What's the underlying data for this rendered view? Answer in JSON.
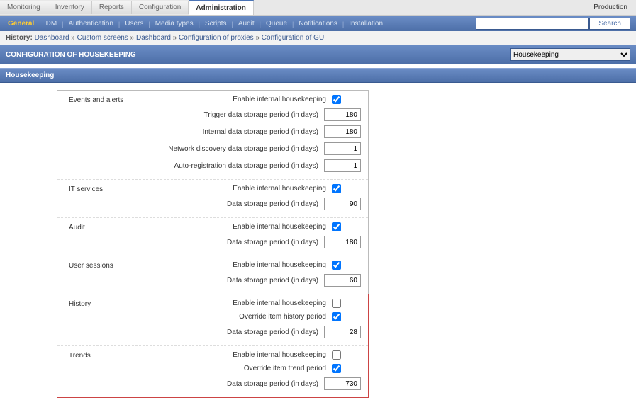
{
  "env": "Production",
  "topTabs": [
    "Monitoring",
    "Inventory",
    "Reports",
    "Configuration",
    "Administration"
  ],
  "topTabActive": "Administration",
  "subTabs": [
    "General",
    "DM",
    "Authentication",
    "Users",
    "Media types",
    "Scripts",
    "Audit",
    "Queue",
    "Notifications",
    "Installation"
  ],
  "search": {
    "placeholder": "",
    "button": "Search"
  },
  "history": {
    "label": "History:",
    "items": [
      "Dashboard",
      "Custom screens",
      "Dashboard",
      "Configuration of proxies",
      "Configuration of GUI"
    ]
  },
  "pageTitle": "CONFIGURATION OF HOUSEKEEPING",
  "selector": {
    "selected": "Housekeeping"
  },
  "sectionTitle": "Housekeeping",
  "groups": [
    {
      "name": "Events and alerts",
      "rows": [
        {
          "label": "Enable internal housekeeping",
          "kind": "check",
          "val": true
        },
        {
          "label": "Trigger data storage period (in days)",
          "kind": "text",
          "val": "180"
        },
        {
          "label": "Internal data storage period (in days)",
          "kind": "text",
          "val": "180"
        },
        {
          "label": "Network discovery data storage period (in days)",
          "kind": "text",
          "val": "1"
        },
        {
          "label": "Auto-registration data storage period (in days)",
          "kind": "text",
          "val": "1"
        }
      ]
    },
    {
      "name": "IT services",
      "rows": [
        {
          "label": "Enable internal housekeeping",
          "kind": "check",
          "val": true
        },
        {
          "label": "Data storage period (in days)",
          "kind": "text",
          "val": "90"
        }
      ]
    },
    {
      "name": "Audit",
      "rows": [
        {
          "label": "Enable internal housekeeping",
          "kind": "check",
          "val": true
        },
        {
          "label": "Data storage period (in days)",
          "kind": "text",
          "val": "180"
        }
      ]
    },
    {
      "name": "User sessions",
      "rows": [
        {
          "label": "Enable internal housekeeping",
          "kind": "check",
          "val": true
        },
        {
          "label": "Data storage period (in days)",
          "kind": "text",
          "val": "60"
        }
      ]
    },
    {
      "name": "History",
      "hl": true,
      "rows": [
        {
          "label": "Enable internal housekeeping",
          "kind": "check",
          "val": false
        },
        {
          "label": "Override item history period",
          "kind": "check",
          "val": true
        },
        {
          "label": "Data storage period (in days)",
          "kind": "text",
          "val": "28"
        }
      ]
    },
    {
      "name": "Trends",
      "hl": true,
      "rows": [
        {
          "label": "Enable internal housekeeping",
          "kind": "check",
          "val": false
        },
        {
          "label": "Override item trend period",
          "kind": "check",
          "val": true
        },
        {
          "label": "Data storage period (in days)",
          "kind": "text",
          "val": "730"
        }
      ]
    }
  ]
}
